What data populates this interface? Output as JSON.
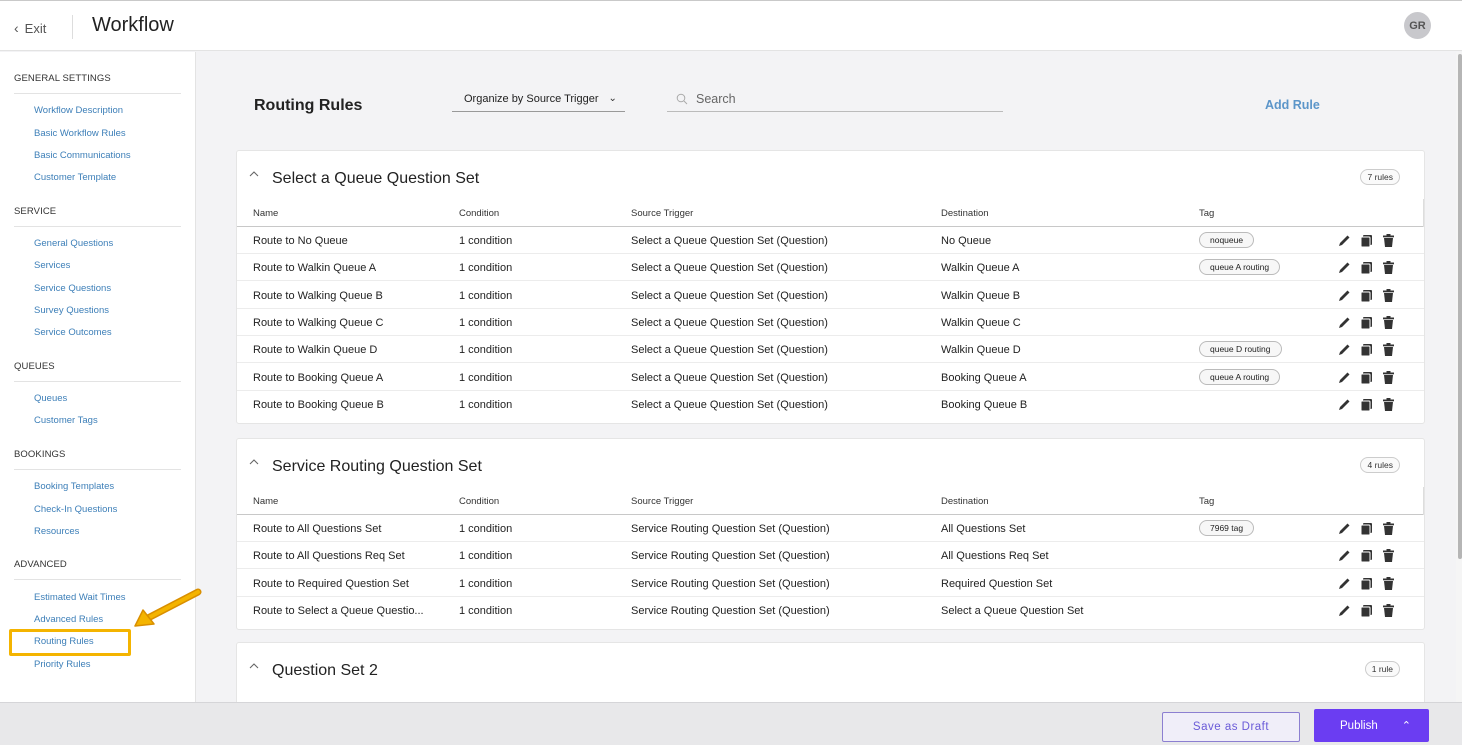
{
  "header": {
    "exit_label": "Exit",
    "title": "Workflow",
    "avatar_initials": "GR"
  },
  "sidebar": {
    "sections": [
      {
        "heading": "GENERAL SETTINGS",
        "items": [
          "Workflow Description",
          "Basic Workflow Rules",
          "Basic Communications",
          "Customer Template"
        ]
      },
      {
        "heading": "SERVICE",
        "items": [
          "General Questions",
          "Services",
          "Service Questions",
          "Survey Questions",
          "Service Outcomes"
        ]
      },
      {
        "heading": "QUEUES",
        "items": [
          "Queues",
          "Customer Tags"
        ]
      },
      {
        "heading": "BOOKINGS",
        "items": [
          "Booking Templates",
          "Check-In Questions",
          "Resources"
        ]
      },
      {
        "heading": "ADVANCED",
        "items": [
          "Estimated Wait Times",
          "Advanced Rules",
          "Routing Rules",
          "Priority Rules"
        ]
      }
    ],
    "highlighted_item": "Routing Rules"
  },
  "main": {
    "heading": "Routing Rules",
    "organize_label": "Organize by Source Trigger",
    "search_placeholder": "Search",
    "add_rule_label": "Add Rule",
    "columns": [
      "Name",
      "Condition",
      "Source Trigger",
      "Destination",
      "Tag"
    ],
    "groups": [
      {
        "title": "Select a Queue Question Set",
        "count": "7 rules",
        "rows": [
          {
            "name": "Route to No Queue",
            "condition": "1 condition",
            "source": "Select a Queue Question Set (Question)",
            "destination": "No Queue",
            "tag": "noqueue"
          },
          {
            "name": "Route to Walkin Queue A",
            "condition": "1 condition",
            "source": "Select a Queue Question Set (Question)",
            "destination": "Walkin Queue A",
            "tag": "queue A routing"
          },
          {
            "name": "Route to Walking Queue B",
            "condition": "1 condition",
            "source": "Select a Queue Question Set (Question)",
            "destination": "Walkin Queue B",
            "tag": ""
          },
          {
            "name": "Route to Walking Queue C",
            "condition": "1 condition",
            "source": "Select a Queue Question Set (Question)",
            "destination": "Walkin Queue C",
            "tag": ""
          },
          {
            "name": "Route to Walkin Queue D",
            "condition": "1 condition",
            "source": "Select a Queue Question Set (Question)",
            "destination": "Walkin Queue D",
            "tag": "queue D routing"
          },
          {
            "name": "Route to Booking Queue A",
            "condition": "1 condition",
            "source": "Select a Queue Question Set (Question)",
            "destination": "Booking Queue A",
            "tag": "queue A routing"
          },
          {
            "name": "Route to Booking Queue B",
            "condition": "1 condition",
            "source": "Select a Queue Question Set (Question)",
            "destination": "Booking Queue B",
            "tag": ""
          }
        ]
      },
      {
        "title": "Service Routing Question Set",
        "count": "4 rules",
        "rows": [
          {
            "name": "Route to All Questions Set",
            "condition": "1 condition",
            "source": "Service Routing Question Set (Question)",
            "destination": "All Questions Set",
            "tag": "7969 tag"
          },
          {
            "name": "Route to All Questions Req Set",
            "condition": "1 condition",
            "source": "Service Routing Question Set (Question)",
            "destination": "All Questions Req Set",
            "tag": ""
          },
          {
            "name": "Route to Required Question Set",
            "condition": "1 condition",
            "source": "Service Routing Question Set (Question)",
            "destination": "Required Question Set",
            "tag": ""
          },
          {
            "name": "Route to Select a Queue Questio...",
            "condition": "1 condition",
            "source": "Service Routing Question Set (Question)",
            "destination": "Select a Queue Question Set",
            "tag": ""
          }
        ]
      },
      {
        "title": "Question Set 2",
        "count": "1 rule",
        "rows": []
      }
    ]
  },
  "footer": {
    "draft_label": "Save as Draft",
    "publish_label": "Publish"
  },
  "colors": {
    "accent": "#6b3df2",
    "link": "#3d7fb8",
    "highlight": "#f4b400"
  }
}
